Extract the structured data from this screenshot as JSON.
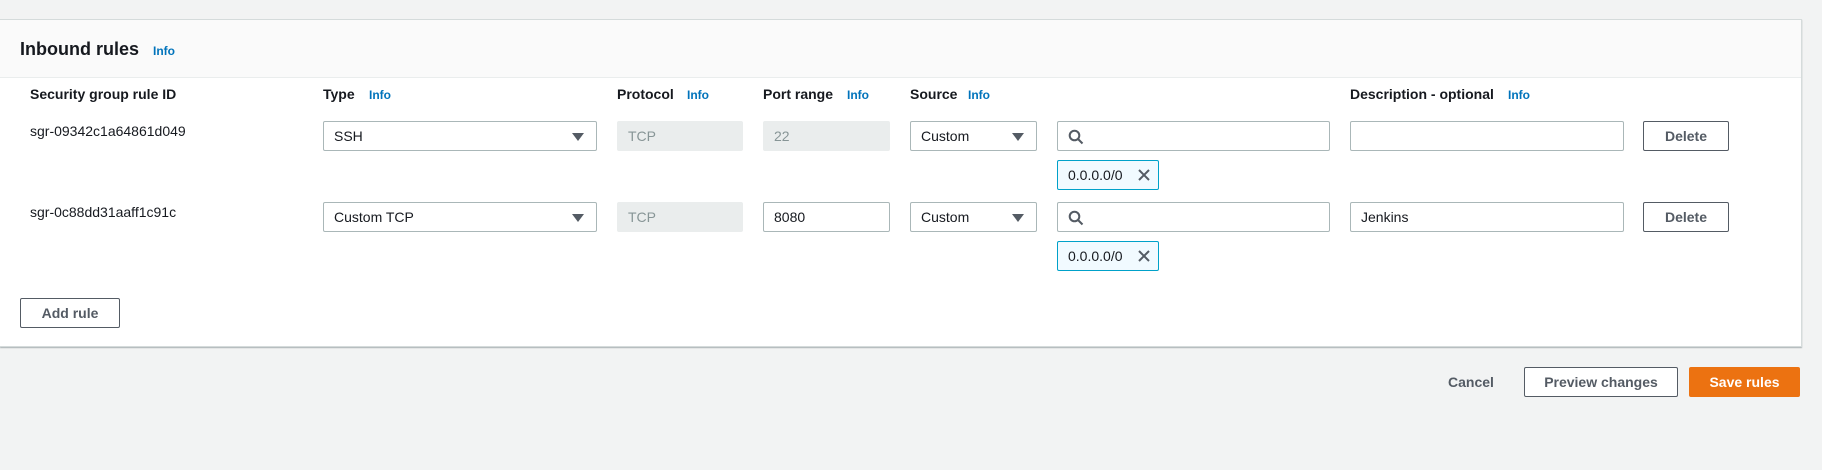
{
  "section": {
    "title": "Inbound rules",
    "info": "Info"
  },
  "columns": {
    "rule_id": "Security group rule ID",
    "type": "Type",
    "type_info": "Info",
    "protocol": "Protocol",
    "protocol_info": "Info",
    "port_range": "Port range",
    "port_info": "Info",
    "source": "Source",
    "source_info": "Info",
    "description": "Description - optional",
    "description_info": "Info"
  },
  "rules": [
    {
      "id": "sgr-09342c1a64861d049",
      "type": "SSH",
      "protocol": "TCP",
      "port": "22",
      "source": "Custom",
      "cidr_search": "",
      "cidr_token": "0.0.0.0/0",
      "description": "",
      "delete": "Delete"
    },
    {
      "id": "sgr-0c88dd31aaff1c91c",
      "type": "Custom TCP",
      "protocol": "TCP",
      "port": "8080",
      "source": "Custom",
      "cidr_search": "",
      "cidr_token": "0.0.0.0/0",
      "description": "Jenkins",
      "delete": "Delete"
    }
  ],
  "add_rule": "Add rule",
  "footer": {
    "cancel": "Cancel",
    "preview": "Preview changes",
    "save": "Save rules"
  },
  "colors": {
    "accent": "#ec7211",
    "link": "#0073bb",
    "token_border": "#00a1c9"
  },
  "icons": {
    "search": "search-icon",
    "remove_token": "close-icon",
    "dropdown": "caret-down-icon"
  }
}
